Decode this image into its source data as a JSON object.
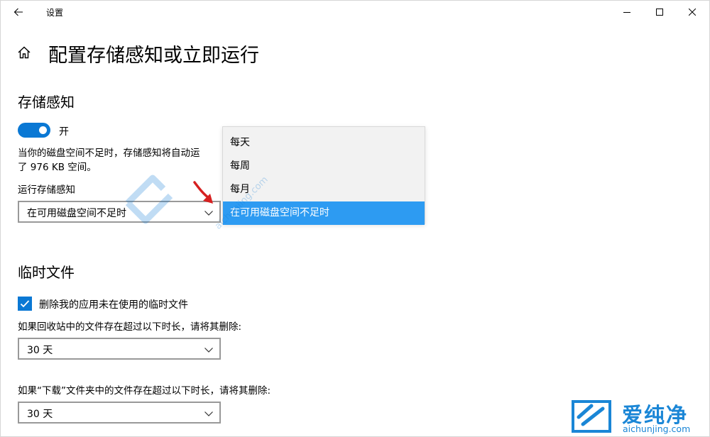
{
  "window": {
    "title": "设置"
  },
  "page": {
    "title": "配置存储感知或立即运行"
  },
  "storage_sense": {
    "heading": "存储感知",
    "toggle_state": "on",
    "toggle_label": "开",
    "description_line1": "当你的磁盘空间不足时，存储感知将自动运",
    "description_line2": "了 976 KB 空间。",
    "run_label": "运行存储感知",
    "run_selected": "在可用磁盘空间不足时",
    "run_options": [
      "每天",
      "每周",
      "每月",
      "在可用磁盘空间不足时"
    ],
    "run_options_selected_index": 3
  },
  "temp_files": {
    "heading": "临时文件",
    "delete_temp_checked": true,
    "delete_temp_label": "删除我的应用未在使用的临时文件",
    "recycle_label": "如果回收站中的文件存在超过以下时长，请将其删除:",
    "recycle_value": "30 天",
    "downloads_label": "如果“下载”文件夹中的文件存在超过以下时长，请将其删除:",
    "downloads_value": "30 天"
  },
  "watermark": {
    "center_text": "aichunjing.com",
    "logo_text": "爱纯净",
    "url_text": "aichunjing.com"
  },
  "colors": {
    "accent": "#0a78d4",
    "selected_item": "#2d9bf2",
    "annotation_arrow": "#d62020"
  }
}
